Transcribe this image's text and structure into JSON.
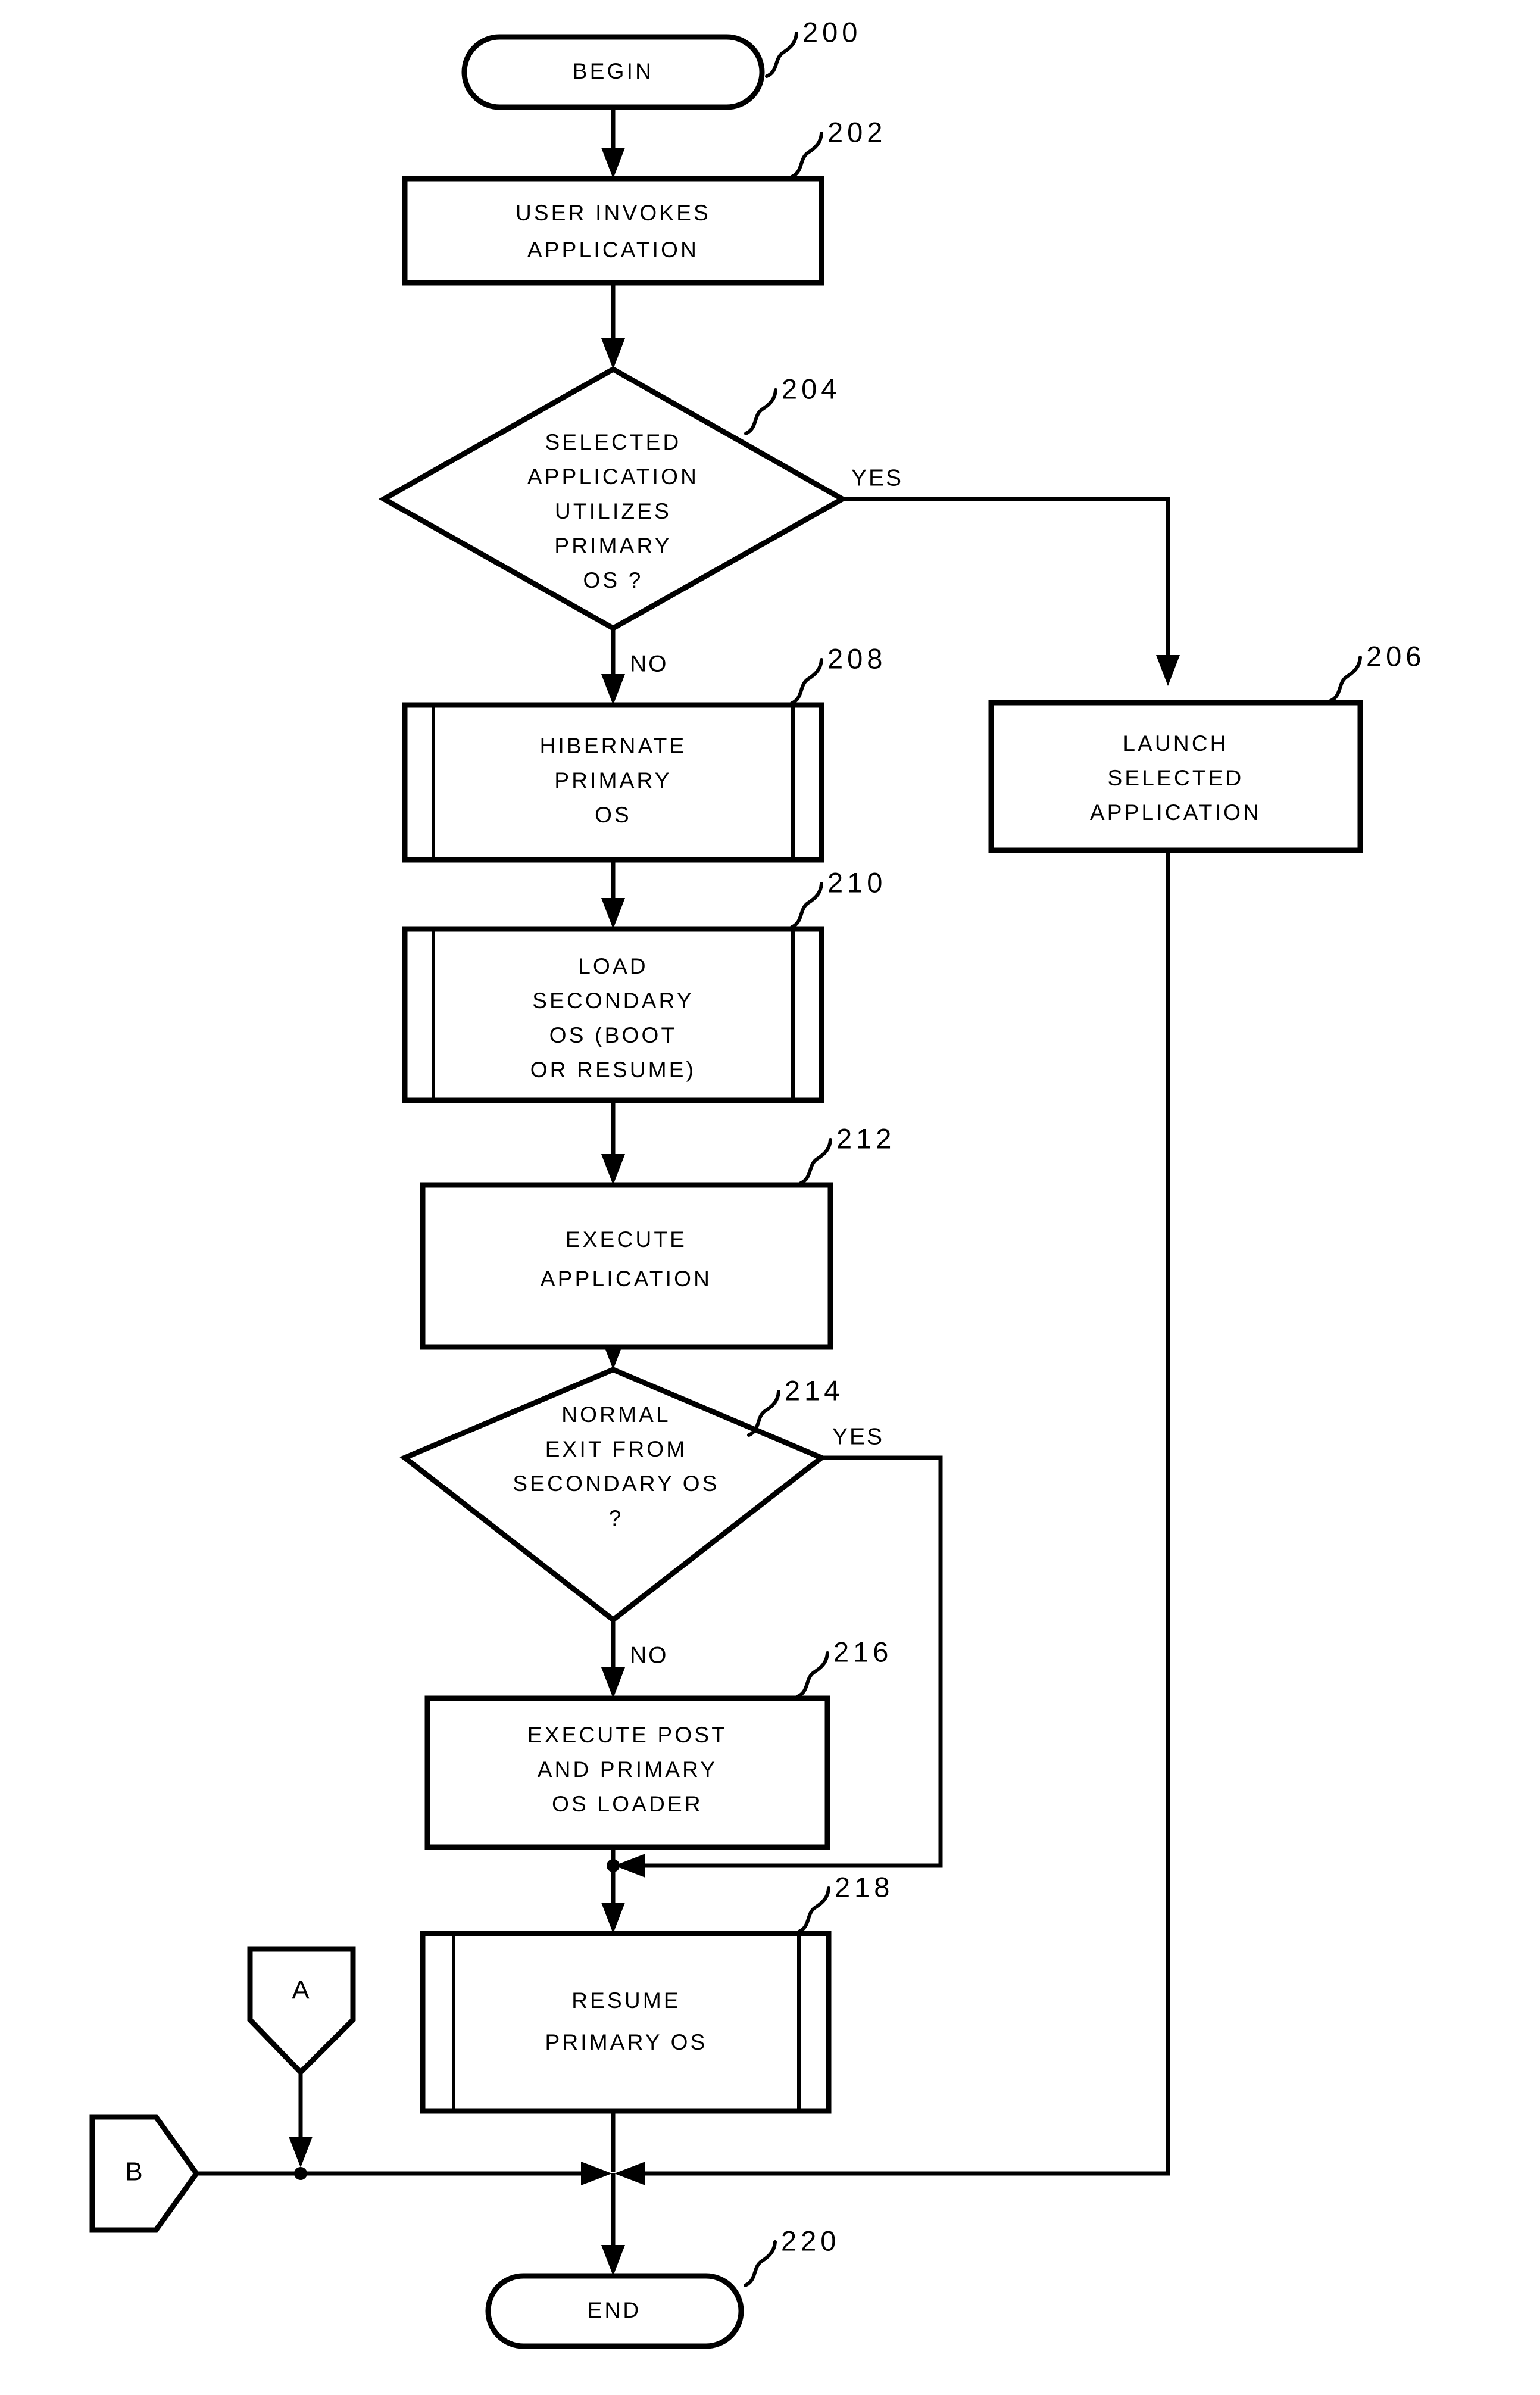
{
  "figure": {
    "type": "patent-flowchart",
    "background_color": "#ffffff",
    "line_color": "#000000"
  },
  "nodes": {
    "begin": {
      "ref": "200",
      "shape": "terminator",
      "lines": [
        "BEGIN"
      ]
    },
    "user_invokes": {
      "ref": "202",
      "shape": "process",
      "lines": [
        "USER INVOKES",
        "APPLICATION"
      ]
    },
    "decision_primary_os": {
      "ref": "204",
      "shape": "decision",
      "lines": [
        "SELECTED",
        "APPLICATION",
        "UTILIZES",
        "PRIMARY",
        "OS ?"
      ]
    },
    "launch_selected": {
      "ref": "206",
      "shape": "process",
      "lines": [
        "LAUNCH",
        "SELECTED",
        "APPLICATION"
      ]
    },
    "hibernate_primary": {
      "ref": "208",
      "shape": "predefined-process",
      "lines": [
        "HIBERNATE",
        "PRIMARY",
        "OS"
      ]
    },
    "load_secondary": {
      "ref": "210",
      "shape": "predefined-process",
      "lines": [
        "LOAD",
        "SECONDARY",
        "OS (BOOT",
        "OR RESUME)"
      ]
    },
    "execute_application": {
      "ref": "212",
      "shape": "process",
      "lines": [
        "EXECUTE",
        "APPLICATION"
      ]
    },
    "decision_normal_exit": {
      "ref": "214",
      "shape": "decision",
      "lines": [
        "NORMAL",
        "EXIT FROM",
        "SECONDARY OS",
        "?"
      ]
    },
    "execute_post": {
      "ref": "216",
      "shape": "process",
      "lines": [
        "EXECUTE POST",
        "AND PRIMARY",
        "OS LOADER"
      ]
    },
    "resume_primary": {
      "ref": "218",
      "shape": "predefined-process",
      "lines": [
        "RESUME",
        "PRIMARY OS"
      ]
    },
    "end": {
      "ref": "220",
      "shape": "terminator",
      "lines": [
        "END"
      ]
    }
  },
  "connectors": {
    "a": {
      "letter": "A",
      "shape": "offpage-connector-down"
    },
    "b": {
      "letter": "B",
      "shape": "offpage-connector-right"
    }
  },
  "branch_labels": {
    "d204_yes": "YES",
    "d204_no": "NO",
    "d214_yes": "YES",
    "d214_no": "NO"
  }
}
